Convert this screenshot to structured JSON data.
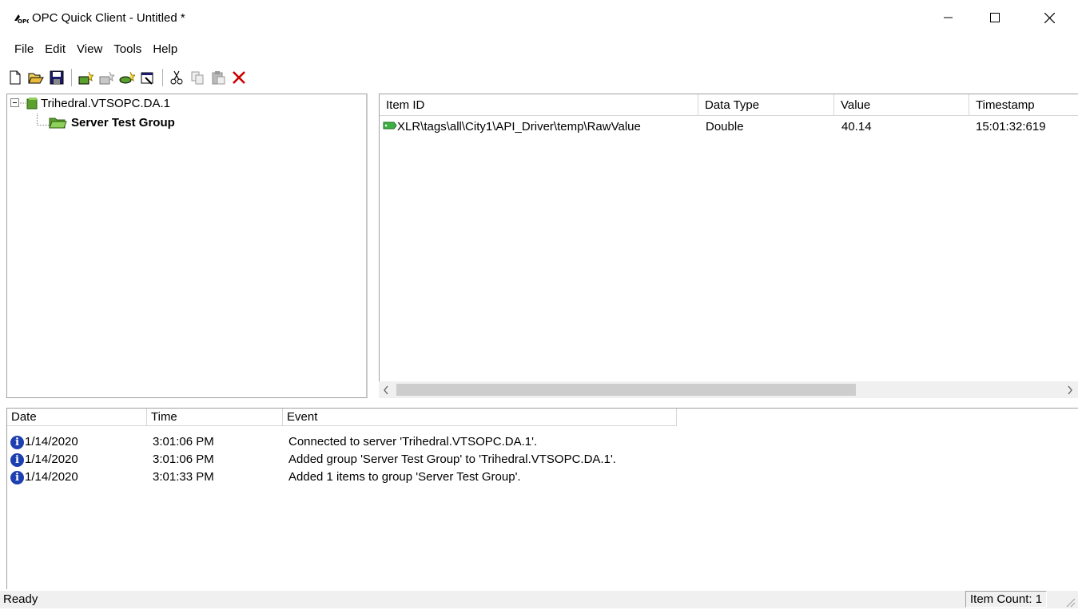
{
  "window": {
    "title": "OPC Quick Client - Untitled *"
  },
  "menu": [
    "File",
    "Edit",
    "View",
    "Tools",
    "Help"
  ],
  "toolbar": {
    "icons": [
      "new-document-icon",
      "open-folder-icon",
      "save-icon",
      "new-server-icon",
      "new-group-icon",
      "new-item-icon",
      "properties-icon",
      "cut-icon",
      "copy-icon",
      "paste-icon",
      "delete-icon"
    ]
  },
  "tree": {
    "root_label": "Trihedral.VTSOPC.DA.1",
    "child_label": "Server Test Group"
  },
  "items_table": {
    "headers": [
      "Item ID",
      "Data Type",
      "Value",
      "Timestamp"
    ],
    "rows": [
      {
        "item_id": "XLR\\tags\\all\\City1\\API_Driver\\temp\\RawValue",
        "data_type": "Double",
        "value": "40.14",
        "timestamp": "15:01:32:619"
      }
    ]
  },
  "log": {
    "headers": [
      "Date",
      "Time",
      "Event"
    ],
    "rows": [
      {
        "date": "1/14/2020",
        "time": "3:01:06 PM",
        "event": "Connected to server 'Trihedral.VTSOPC.DA.1'."
      },
      {
        "date": "1/14/2020",
        "time": "3:01:06 PM",
        "event": "Added group 'Server Test Group' to 'Trihedral.VTSOPC.DA.1'."
      },
      {
        "date": "1/14/2020",
        "time": "3:01:33 PM",
        "event": "Added 1 items to group 'Server Test Group'."
      }
    ]
  },
  "status": {
    "text": "Ready",
    "item_count": "Item Count: 1"
  },
  "colors": {
    "info_icon": "#1e3fb0",
    "tag_icon": "#3cb043",
    "delete_icon": "#cc0000"
  }
}
